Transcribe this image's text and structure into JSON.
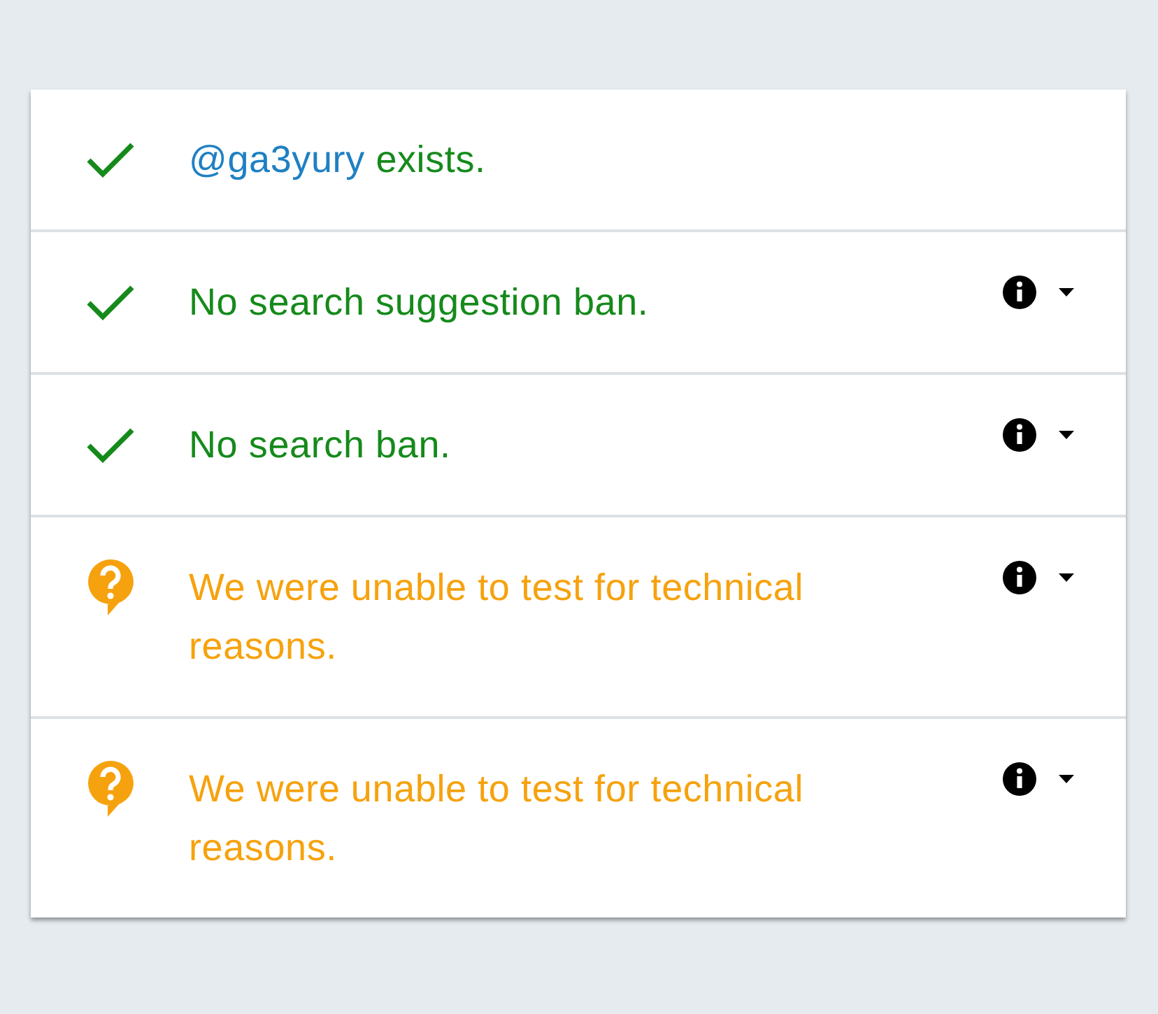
{
  "results": [
    {
      "kind": "passed",
      "link": "@ga3yury",
      "text": "exists."
    },
    {
      "kind": "passed",
      "text": "No search suggestion ban.",
      "details": {
        "expanded": false
      }
    },
    {
      "kind": "passed",
      "text": "No search ban.",
      "details": {
        "expanded": false
      }
    },
    {
      "kind": "unknown",
      "text": "We were unable to test for technical reasons.",
      "details": {
        "expanded": false
      }
    },
    {
      "kind": "unknown",
      "text": "We were unable to test for technical reasons.",
      "details": {
        "expanded": false
      }
    }
  ]
}
